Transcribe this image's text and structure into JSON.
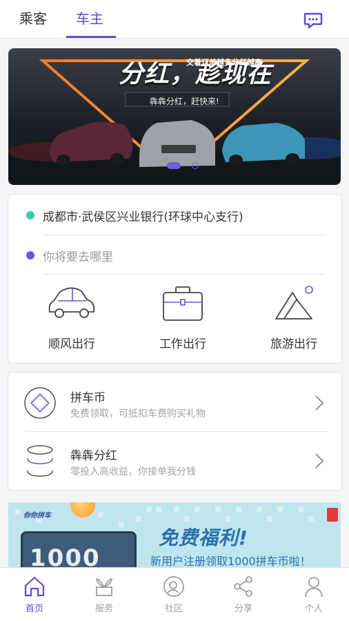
{
  "header": {
    "tabs": [
      {
        "label": "乘客",
        "active": false
      },
      {
        "label": "车主",
        "active": true
      }
    ],
    "message_icon": "message-icon"
  },
  "banner": {
    "title": "分红，趁现在",
    "subtitle_top": "交着订单越多分红越高",
    "subtitle": "犇犇分红，赶快来!",
    "carousel_index": 1,
    "carousel_count": 2
  },
  "route": {
    "from": "成都市·武侯区兴业银行(环球中心支行)",
    "to_placeholder": "你将要去哪里",
    "from_color": "#2fcfb0",
    "to_color": "#6a55e0",
    "trip_types": [
      {
        "label": "顺风出行",
        "icon": "car-icon"
      },
      {
        "label": "工作出行",
        "icon": "briefcase-icon"
      },
      {
        "label": "旅游出行",
        "icon": "mountain-icon"
      }
    ]
  },
  "promos": [
    {
      "title": "拼车币",
      "subtitle": "免费领取，可抵扣车费购买礼物",
      "icon": "coin-icon"
    },
    {
      "title": "犇犇分红",
      "subtitle": "零投入高收益，你接单我分钱",
      "icon": "stack-icon"
    }
  ],
  "promo_banner": {
    "brand": "你你拼车",
    "headline": "免费福利!",
    "text": "新用户注册领取1000拼车币啦！",
    "card_number": "1000"
  },
  "bottom_nav": [
    {
      "label": "首页",
      "icon": "home-icon",
      "active": true
    },
    {
      "label": "服务",
      "icon": "plant-icon",
      "active": false
    },
    {
      "label": "社区",
      "icon": "community-icon",
      "active": false
    },
    {
      "label": "分享",
      "icon": "share-icon",
      "active": false
    },
    {
      "label": "个人",
      "icon": "person-icon",
      "active": false
    }
  ],
  "colors": {
    "accent": "#5b4bd6",
    "icon_stroke": "#333333"
  }
}
